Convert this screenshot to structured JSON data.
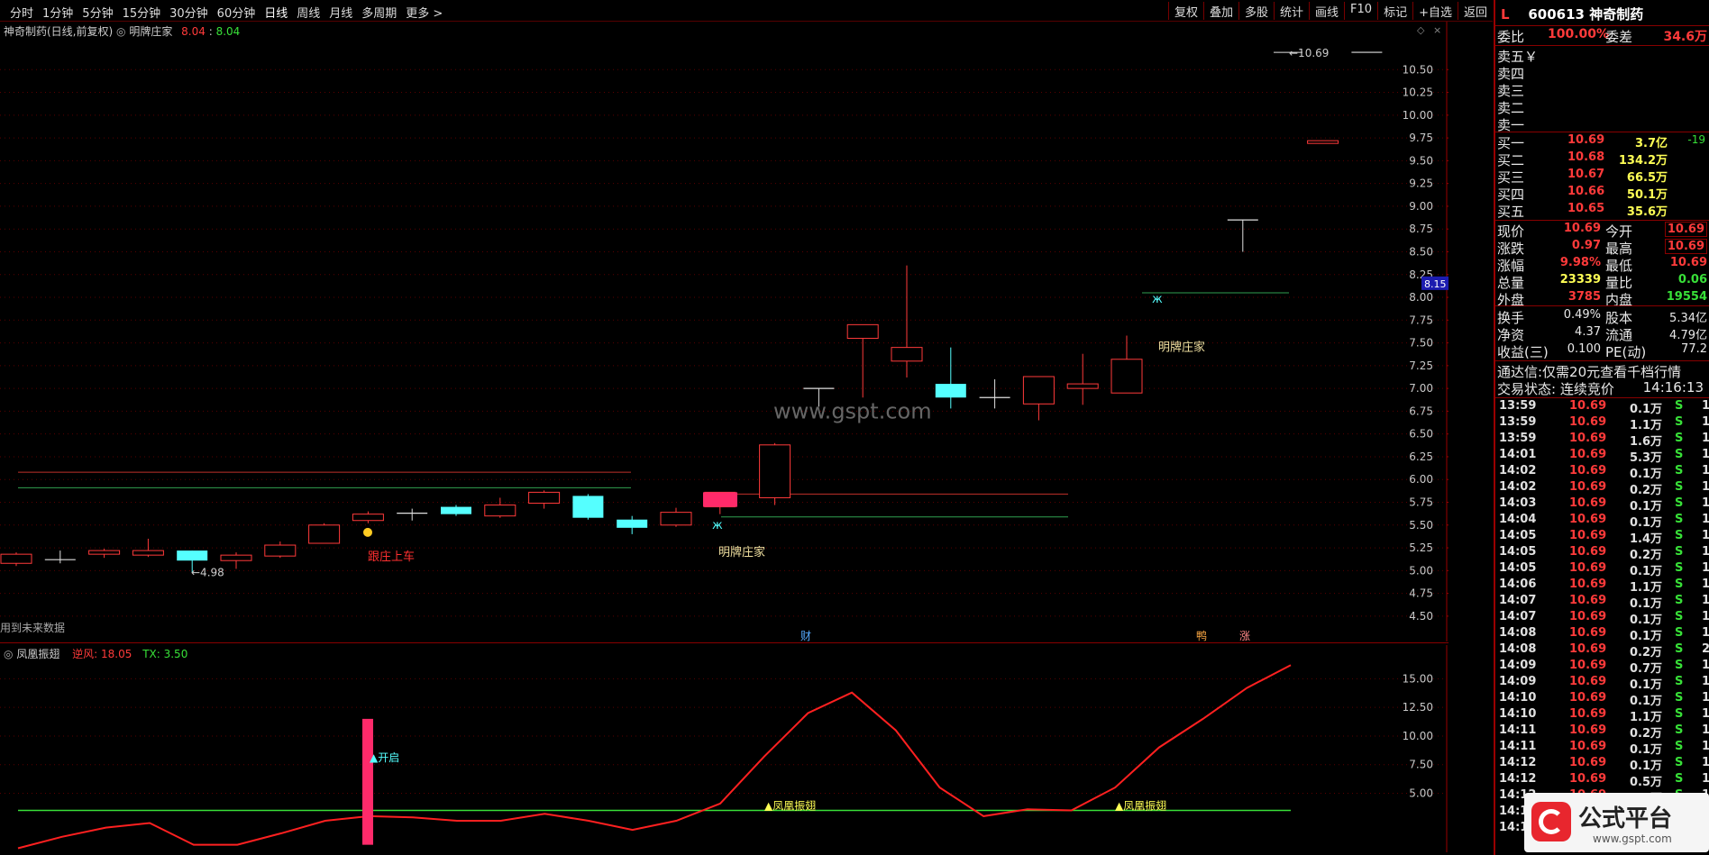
{
  "toolbar": {
    "periods": [
      "分时",
      "1分钟",
      "5分钟",
      "15分钟",
      "30分钟",
      "60分钟",
      "日线",
      "周线",
      "月线",
      "多周期",
      "更多 >"
    ],
    "buttons": [
      "复权",
      "叠加",
      "多股",
      "统计",
      "画线",
      "F10",
      "标记",
      "+自选",
      "返回"
    ]
  },
  "main": {
    "title_stock": "神奇制药(日线,前复权)",
    "indicator_name": "明牌庄家",
    "ind_val1": "8.04",
    "ind_val2": "8.04",
    "future_note": "用到未来数据",
    "current_price_tag": "8.15",
    "high_label": "10.69",
    "low_label": "4.98",
    "watermark": "www.gspt.com",
    "label_follow": "跟庄上车",
    "label_mpzj1": "明牌庄家",
    "label_mpzj2": "明牌庄家",
    "marker_cai": "财",
    "marker_zhang": "涨",
    "marker_ya": "鸭",
    "y_ticks": [
      "10.50",
      "10.25",
      "10.00",
      "9.75",
      "9.50",
      "9.25",
      "9.00",
      "8.75",
      "8.50",
      "8.25",
      "8.00",
      "7.75",
      "7.50",
      "7.25",
      "7.00",
      "6.75",
      "6.50",
      "6.25",
      "6.00",
      "5.75",
      "5.50",
      "5.25",
      "5.00",
      "4.75",
      "4.50"
    ]
  },
  "indicator": {
    "name": "凤凰振翅",
    "line1_label": "逆风: 18.05",
    "line2_label": "TX: 3.50",
    "open_label": "▲开启",
    "fenghuang1": "▲凤凰振翅",
    "fenghuang2": "▲凤凰振翅",
    "y_ticks": [
      "15.00",
      "12.50",
      "10.00",
      "7.50",
      "5.00"
    ]
  },
  "quote": {
    "tag": "L",
    "code_name": "600613 神奇制药",
    "weibi_label": "委比",
    "weibi_val": "100.00%",
    "weicha_label": "委差",
    "weicha_val": "34.6万",
    "asks": [
      {
        "label": "卖五",
        "extra": "￥"
      },
      {
        "label": "卖四",
        "extra": ""
      },
      {
        "label": "卖三",
        "extra": ""
      },
      {
        "label": "卖二",
        "extra": ""
      },
      {
        "label": "卖一",
        "extra": ""
      }
    ],
    "bids": [
      {
        "label": "买一",
        "price": "10.69",
        "vol": "3.7亿",
        "chg": "-19"
      },
      {
        "label": "买二",
        "price": "10.68",
        "vol": "134.2万",
        "chg": ""
      },
      {
        "label": "买三",
        "price": "10.67",
        "vol": "66.5万",
        "chg": ""
      },
      {
        "label": "买四",
        "price": "10.66",
        "vol": "50.1万",
        "chg": ""
      },
      {
        "label": "买五",
        "price": "10.65",
        "vol": "35.6万",
        "chg": ""
      }
    ],
    "stats": [
      {
        "l1": "现价",
        "v1": "10.69",
        "l2": "今开",
        "v2": "10.69"
      },
      {
        "l1": "涨跌",
        "v1": "0.97",
        "l2": "最高",
        "v2": "10.69"
      },
      {
        "l1": "涨幅",
        "v1": "9.98%",
        "l2": "最低",
        "v2": "10.69"
      },
      {
        "l1": "总量",
        "v1": "23339",
        "l2": "量比",
        "v2": "0.06"
      },
      {
        "l1": "外盘",
        "v1": "3785",
        "l2": "内盘",
        "v2": "19554"
      }
    ],
    "stats2": [
      {
        "l1": "换手",
        "v1": "0.49%",
        "l2": "股本",
        "v2": "5.34亿"
      },
      {
        "l1": "净资",
        "v1": "4.37",
        "l2": "流通",
        "v2": "4.79亿"
      },
      {
        "l1": "收益(三)",
        "v1": "0.100",
        "l2": "PE(动)",
        "v2": "77.2"
      }
    ],
    "promo": "通达信:仅需20元查看千档行情",
    "trade_state_label": "交易状态: 连续竞价",
    "trade_time": "14:16:13",
    "ticks": [
      {
        "t": "13:59",
        "p": "10.69",
        "v": "0.1万",
        "s": "S",
        "n": "1"
      },
      {
        "t": "13:59",
        "p": "10.69",
        "v": "1.1万",
        "s": "S",
        "n": "1"
      },
      {
        "t": "13:59",
        "p": "10.69",
        "v": "1.6万",
        "s": "S",
        "n": "1"
      },
      {
        "t": "14:01",
        "p": "10.69",
        "v": "5.3万",
        "s": "S",
        "n": "1"
      },
      {
        "t": "14:02",
        "p": "10.69",
        "v": "0.1万",
        "s": "S",
        "n": "1"
      },
      {
        "t": "14:02",
        "p": "10.69",
        "v": "0.2万",
        "s": "S",
        "n": "1"
      },
      {
        "t": "14:03",
        "p": "10.69",
        "v": "0.1万",
        "s": "S",
        "n": "1"
      },
      {
        "t": "14:04",
        "p": "10.69",
        "v": "0.1万",
        "s": "S",
        "n": "1"
      },
      {
        "t": "14:05",
        "p": "10.69",
        "v": "1.4万",
        "s": "S",
        "n": "1"
      },
      {
        "t": "14:05",
        "p": "10.69",
        "v": "0.2万",
        "s": "S",
        "n": "1"
      },
      {
        "t": "14:05",
        "p": "10.69",
        "v": "0.1万",
        "s": "S",
        "n": "1"
      },
      {
        "t": "14:06",
        "p": "10.69",
        "v": "1.1万",
        "s": "S",
        "n": "1"
      },
      {
        "t": "14:07",
        "p": "10.69",
        "v": "0.1万",
        "s": "S",
        "n": "1"
      },
      {
        "t": "14:07",
        "p": "10.69",
        "v": "0.1万",
        "s": "S",
        "n": "1"
      },
      {
        "t": "14:08",
        "p": "10.69",
        "v": "0.1万",
        "s": "S",
        "n": "1"
      },
      {
        "t": "14:08",
        "p": "10.69",
        "v": "0.2万",
        "s": "S",
        "n": "2"
      },
      {
        "t": "14:09",
        "p": "10.69",
        "v": "0.7万",
        "s": "S",
        "n": "1"
      },
      {
        "t": "14:09",
        "p": "10.69",
        "v": "0.1万",
        "s": "S",
        "n": "1"
      },
      {
        "t": "14:10",
        "p": "10.69",
        "v": "0.1万",
        "s": "S",
        "n": "1"
      },
      {
        "t": "14:10",
        "p": "10.69",
        "v": "1.1万",
        "s": "S",
        "n": "1"
      },
      {
        "t": "14:11",
        "p": "10.69",
        "v": "0.2万",
        "s": "S",
        "n": "1"
      },
      {
        "t": "14:11",
        "p": "10.69",
        "v": "0.1万",
        "s": "S",
        "n": "1"
      },
      {
        "t": "14:12",
        "p": "10.69",
        "v": "0.1万",
        "s": "S",
        "n": "1"
      },
      {
        "t": "14:12",
        "p": "10.69",
        "v": "0.5万",
        "s": "S",
        "n": "1"
      },
      {
        "t": "14:12",
        "p": "10.69",
        "v": "1.1万",
        "s": "S",
        "n": "1"
      },
      {
        "t": "14:1",
        "p": "",
        "v": "",
        "s": "",
        "n": ""
      },
      {
        "t": "14:1",
        "p": "",
        "v": "",
        "s": "",
        "n": ""
      }
    ],
    "logo_text": "公式平台",
    "logo_url": "www.gspt.com"
  },
  "chart_data": [
    {
      "type": "candlestick",
      "title": "神奇制药(日线,前复权)",
      "ylim": [
        4.4,
        10.75
      ],
      "candles": [
        {
          "o": 5.08,
          "c": 5.18,
          "h": 5.2,
          "l": 5.05
        },
        {
          "o": 5.12,
          "c": 5.12,
          "h": 5.22,
          "l": 5.08
        },
        {
          "o": 5.18,
          "c": 5.22,
          "h": 5.24,
          "l": 5.14
        },
        {
          "o": 5.17,
          "c": 5.22,
          "h": 5.35,
          "l": 5.15
        },
        {
          "o": 5.22,
          "c": 5.11,
          "h": 5.22,
          "l": 4.98
        },
        {
          "o": 5.11,
          "c": 5.17,
          "h": 5.2,
          "l": 5.02
        },
        {
          "o": 5.16,
          "c": 5.28,
          "h": 5.32,
          "l": 5.14
        },
        {
          "o": 5.3,
          "c": 5.5,
          "h": 5.52,
          "l": 5.3
        },
        {
          "o": 5.55,
          "c": 5.62,
          "h": 5.65,
          "l": 5.52
        },
        {
          "o": 5.63,
          "c": 5.63,
          "h": 5.68,
          "l": 5.55
        },
        {
          "o": 5.7,
          "c": 5.62,
          "h": 5.72,
          "l": 5.6
        },
        {
          "o": 5.6,
          "c": 5.72,
          "h": 5.8,
          "l": 5.58
        },
        {
          "o": 5.74,
          "c": 5.86,
          "h": 5.88,
          "l": 5.68
        },
        {
          "o": 5.82,
          "c": 5.58,
          "h": 5.84,
          "l": 5.56
        },
        {
          "o": 5.56,
          "c": 5.47,
          "h": 5.6,
          "l": 5.4
        },
        {
          "o": 5.5,
          "c": 5.64,
          "h": 5.69,
          "l": 5.48
        },
        {
          "o": 5.7,
          "c": 5.86,
          "h": 5.86,
          "l": 5.62
        },
        {
          "o": 5.8,
          "c": 6.38,
          "h": 6.4,
          "l": 5.72
        },
        {
          "o": 7.0,
          "c": 7.0,
          "h": 7.0,
          "l": 6.8
        },
        {
          "o": 7.55,
          "c": 7.7,
          "h": 7.7,
          "l": 6.9
        },
        {
          "o": 7.3,
          "c": 7.45,
          "h": 8.35,
          "l": 7.12
        },
        {
          "o": 7.05,
          "c": 6.9,
          "h": 7.45,
          "l": 6.78
        },
        {
          "o": 6.9,
          "c": 6.9,
          "h": 7.1,
          "l": 6.78
        },
        {
          "o": 6.83,
          "c": 7.13,
          "h": 7.13,
          "l": 6.65
        },
        {
          "o": 7.0,
          "c": 7.05,
          "h": 7.38,
          "l": 6.82
        },
        {
          "o": 6.95,
          "c": 7.32,
          "h": 7.58,
          "l": 6.95
        },
        {
          "o": 8.85,
          "c": 8.85,
          "h": 8.85,
          "l": 8.5
        },
        {
          "o": 9.69,
          "c": 9.72,
          "h": 9.72,
          "l": 9.69
        },
        {
          "o": 10.69,
          "c": 10.69,
          "h": 10.69,
          "l": 10.69
        }
      ],
      "up_color": "#ff3a3a",
      "down_color": "#55ffff"
    },
    {
      "type": "line",
      "title": "凤凰振翅",
      "ylim": [
        0,
        17
      ],
      "series": [
        {
          "name": "逆风",
          "values": [
            0.2,
            1.2,
            2.0,
            2.4,
            0.5,
            0.5,
            1.5,
            2.6,
            3.0,
            2.9,
            2.6,
            2.6,
            3.2,
            2.6,
            1.8,
            2.6,
            4.1,
            8.2,
            12.0,
            13.8,
            10.5,
            5.5,
            3.0,
            3.6,
            3.5,
            5.5,
            9.0,
            11.5,
            14.2,
            16.2
          ]
        },
        {
          "name": "TX",
          "values": [
            3.5,
            3.5,
            3.5,
            3.5,
            3.5,
            3.5,
            3.5,
            3.5,
            3.5,
            3.5,
            3.5,
            3.5,
            3.5,
            3.5,
            3.5,
            3.5,
            3.5,
            3.5,
            3.5,
            3.5,
            3.5,
            3.5,
            3.5,
            3.5,
            3.5,
            3.5,
            3.5,
            3.5,
            3.5,
            3.5
          ]
        }
      ]
    }
  ]
}
